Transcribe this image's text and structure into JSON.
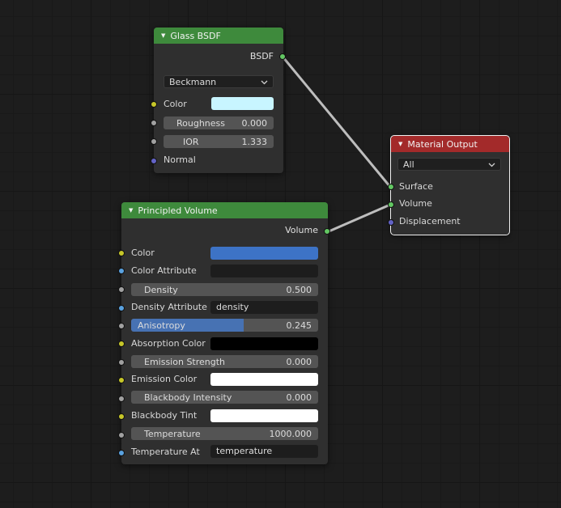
{
  "colors": {
    "float_socket": "#a1a1a1",
    "color_socket": "#c7c729",
    "vector_socket": "#6363c7",
    "shader_socket": "#63c763",
    "attr_socket": "#5aa2e0",
    "shader_header": "#3e8a3c",
    "output_header": "#a32a2a",
    "link": "#bdbdbd"
  },
  "glass_bsdf": {
    "title": "Glass BSDF",
    "output": "BSDF",
    "distribution": "Beckmann",
    "color_label": "Color",
    "color_value": "#c8f5ff",
    "roughness_label": "Roughness",
    "roughness_value": "0.000",
    "ior_label": "IOR",
    "ior_value": "1.333",
    "normal_label": "Normal"
  },
  "material_output": {
    "title": "Material Output",
    "target": "All",
    "surface_label": "Surface",
    "volume_label": "Volume",
    "displacement_label": "Displacement"
  },
  "principled_volume": {
    "title": "Principled Volume",
    "output": "Volume",
    "color_label": "Color",
    "color_value": "#3d73c6",
    "color_attr_label": "Color Attribute",
    "color_attr_value": "",
    "density_label": "Density",
    "density_value": "0.500",
    "density_attr_label": "Density Attribute",
    "density_attr_value": "density",
    "anisotropy_label": "Anisotropy",
    "anisotropy_value": "0.245",
    "anisotropy_fraction": 0.6,
    "absorption_label": "Absorption Color",
    "absorption_value": "#000000",
    "emission_strength_label": "Emission Strength",
    "emission_strength_value": "0.000",
    "emission_color_label": "Emission Color",
    "emission_color_value": "#ffffff",
    "blackbody_intensity_label": "Blackbody Intensity",
    "blackbody_intensity_value": "0.000",
    "blackbody_tint_label": "Blackbody Tint",
    "blackbody_tint_value": "#ffffff",
    "temperature_label": "Temperature",
    "temperature_value": "1000.000",
    "temperature_attr_label": "Temperature At",
    "temperature_attr_value": "temperature"
  }
}
